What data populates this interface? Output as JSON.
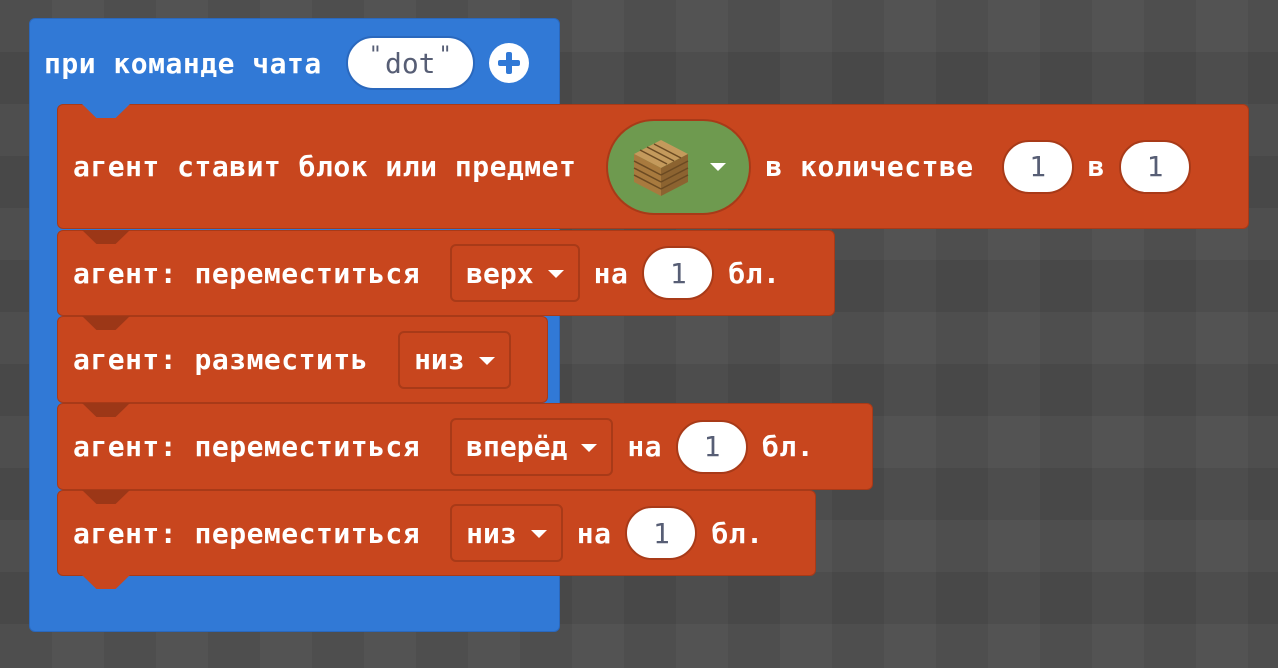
{
  "hat": {
    "label": "при команде чата",
    "command_value": "dot",
    "quote_open": "\"",
    "quote_close": "\"",
    "add_param_icon": "plus-circle-icon",
    "color": "#3179d6"
  },
  "blocks": {
    "color": "#c8461e",
    "place": {
      "label": "агент ставит блок или предмет",
      "item_icon": "oak-planks-icon",
      "count_label": "в количестве",
      "count_value": "1",
      "slot_label": "в",
      "slot_value": "1"
    },
    "move_up": {
      "label": "агент: переместиться",
      "direction": "верх",
      "on_label": "на",
      "amount": "1",
      "unit": "бл."
    },
    "place_down": {
      "label": "агент: разместить",
      "direction": "низ"
    },
    "move_forward": {
      "label": "агент: переместиться",
      "direction": "вперёд",
      "on_label": "на",
      "amount": "1",
      "unit": "бл."
    },
    "move_down": {
      "label": "агент: переместиться",
      "direction": "низ",
      "on_label": "на",
      "amount": "1",
      "unit": "бл."
    }
  }
}
